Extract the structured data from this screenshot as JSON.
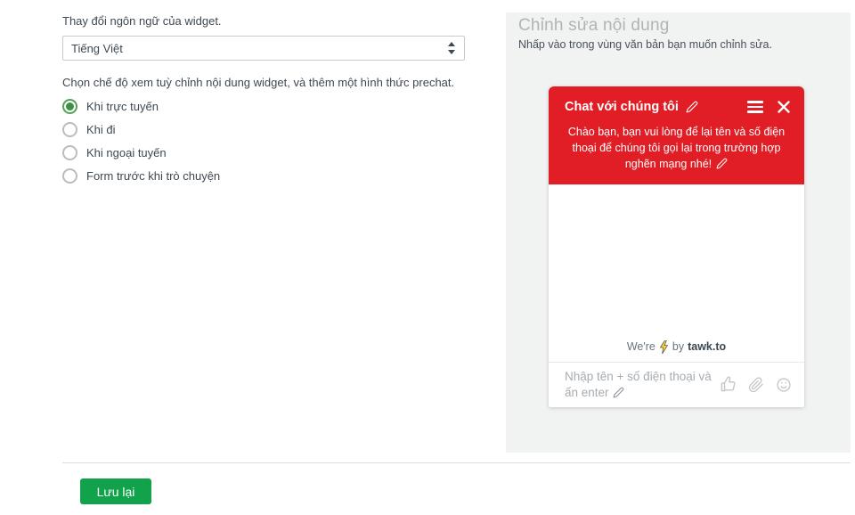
{
  "language_section": {
    "label": "Thay đổi ngôn ngữ của widget.",
    "select_value": "Tiếng Việt"
  },
  "mode_section": {
    "label": "Chọn chế độ xem tuỳ chỉnh nội dung widget, và thêm một hình thức prechat.",
    "options": [
      {
        "label": "Khi trực tuyến",
        "selected": true
      },
      {
        "label": "Khi đi",
        "selected": false
      },
      {
        "label": "Khi ngoại tuyến",
        "selected": false
      },
      {
        "label": "Form trước khi trò chuyện",
        "selected": false
      }
    ]
  },
  "editor_panel": {
    "title": "Chỉnh sửa nội dung",
    "subtitle": "Nhấp vào trong vùng văn bản bạn muốn chỉnh sửa."
  },
  "chat_widget": {
    "header_title": "Chat với chúng tôi",
    "message": "Chào bạn, bạn vui lòng để lại tên và số điện thoại để chúng tôi gọi lại trong trường hợp nghẽn mạng nhé!",
    "branding": {
      "prefix": "We're",
      "middle": "by",
      "brand": "tawk.to"
    },
    "input_placeholder": "Nhập tên + số điện thoại và ấn enter"
  },
  "footer": {
    "save_label": "Lưu lại"
  },
  "icons": {
    "select_stepper": "up-down-arrows",
    "edit": "pencil",
    "menu": "hamburger",
    "close": "x",
    "like": "thumbs-up",
    "attach": "paperclip",
    "emoji": "smiley-face",
    "bolt": "lightning"
  },
  "colors": {
    "widget_red": "#e11e25",
    "save_green": "#12a24b",
    "radio_selected_green": "#4a9b51",
    "panel_gray": "#f1f2f2",
    "bolt_yellow": "#fdd32f",
    "brand_text": "#3a4750"
  }
}
